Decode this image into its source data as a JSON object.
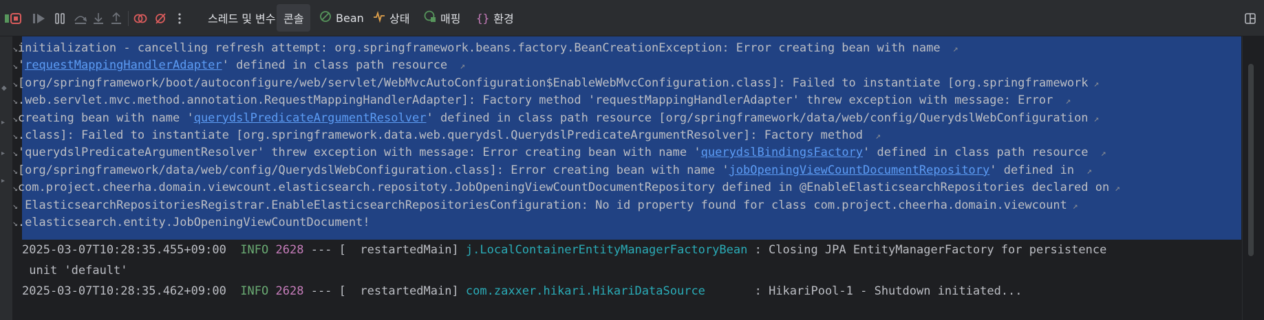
{
  "toolbar": {
    "tabs": [
      {
        "label": "스레드 및 변수",
        "icon": ""
      },
      {
        "label": "콘솔",
        "icon": ""
      },
      {
        "label": "Bean",
        "icon": "bean-icon"
      },
      {
        "label": "상태",
        "icon": "health-icon"
      },
      {
        "label": "매핑",
        "icon": "mapping-icon"
      },
      {
        "label": "환경",
        "icon": "environment-icon"
      }
    ]
  },
  "console": {
    "selected_lines": [
      {
        "parts": [
          {
            "t": "initialization - cancelling refresh attempt: org.springframework.beans.factory.BeanCreationException: Error creating bean with name ",
            "c": "plain"
          }
        ]
      },
      {
        "parts": [
          {
            "t": "'",
            "c": "plain"
          },
          {
            "t": "requestMappingHandlerAdapter",
            "c": "link"
          },
          {
            "t": "' defined in class path resource ",
            "c": "plain"
          }
        ]
      },
      {
        "parts": [
          {
            "t": "[org/springframework/boot/autoconfigure/web/servlet/WebMvcAutoConfiguration$EnableWebMvcConfiguration.class]: Failed to instantiate [org.springframework",
            "c": "plain"
          }
        ]
      },
      {
        "parts": [
          {
            "t": ".web.servlet.mvc.method.annotation.RequestMappingHandlerAdapter]: Factory method 'requestMappingHandlerAdapter' threw exception with message: Error ",
            "c": "plain"
          }
        ]
      },
      {
        "parts": [
          {
            "t": "creating bean with name '",
            "c": "plain"
          },
          {
            "t": "querydslPredicateArgumentResolver",
            "c": "link"
          },
          {
            "t": "' defined in class path resource [org/springframework/data/web/config/QuerydslWebConfiguration",
            "c": "plain"
          }
        ]
      },
      {
        "parts": [
          {
            "t": ".class]: Failed to instantiate [org.springframework.data.web.querydsl.QuerydslPredicateArgumentResolver]: Factory method ",
            "c": "plain"
          }
        ]
      },
      {
        "parts": [
          {
            "t": "'querydslPredicateArgumentResolver' threw exception with message: Error creating bean with name '",
            "c": "plain"
          },
          {
            "t": "querydslBindingsFactory",
            "c": "link"
          },
          {
            "t": "' defined in class path resource ",
            "c": "plain"
          }
        ]
      },
      {
        "parts": [
          {
            "t": "[org/springframework/data/web/config/QuerydslWebConfiguration.class]: Error creating bean with name '",
            "c": "plain"
          },
          {
            "t": "jobOpeningViewCountDocumentRepository",
            "c": "link"
          },
          {
            "t": "' defined in ",
            "c": "plain"
          }
        ]
      },
      {
        "parts": [
          {
            "t": "com.project.cheerha.domain.viewcount.elasticsearch.repositoty.JobOpeningViewCountDocumentRepository defined in @EnableElasticsearchRepositories declared on",
            "c": "plain"
          }
        ]
      },
      {
        "parts": [
          {
            "t": " ElasticsearchRepositoriesRegistrar.EnableElasticsearchRepositoriesConfiguration: No id property found for class com.project.cheerha.domain.viewcount",
            "c": "plain"
          }
        ]
      },
      {
        "parts": [
          {
            "t": ".elasticsearch.entity.JobOpeningViewCountDocument!",
            "c": "plain"
          }
        ]
      }
    ],
    "log_lines": [
      {
        "timestamp": "2025-03-07T10:28:35.455+09:00",
        "level": "INFO",
        "pid": "2628",
        "sep": "---",
        "thread": "[  restartedMain]",
        "logger": "j.LocalContainerEntityManagerFactoryBean",
        "pad": "",
        "message": ": Closing JPA EntityManagerFactory for persistence"
      },
      {
        "continuation": " unit 'default'"
      },
      {
        "timestamp": "2025-03-07T10:28:35.462+09:00",
        "level": "INFO",
        "pid": "2628",
        "sep": "---",
        "thread": "[  restartedMain]",
        "logger": "com.zaxxer.hikari.HikariDataSource",
        "pad": "      ",
        "message": ": HikariPool-1 - Shutdown initiated..."
      }
    ]
  },
  "colors": {
    "selection": "#214283",
    "link": "#5c9cf5",
    "info": "#6aab73",
    "pid": "#c77dbb",
    "logger": "#2aacb8"
  }
}
